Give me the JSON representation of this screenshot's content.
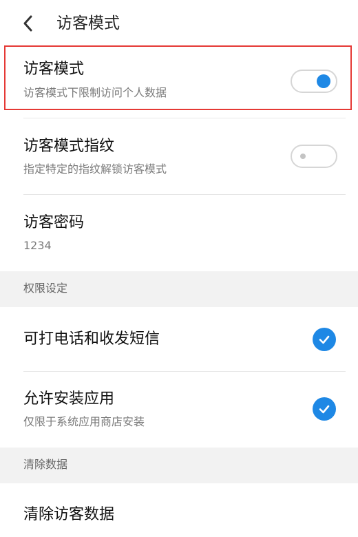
{
  "header": {
    "title": "访客模式",
    "back_icon": "chevron-left-icon"
  },
  "settings": {
    "guest_mode": {
      "title": "访客模式",
      "subtitle": "访客模式下限制访问个人数据",
      "enabled": true
    },
    "guest_fingerprint": {
      "title": "访客模式指纹",
      "subtitle": "指定特定的指纹解锁访客模式",
      "enabled": false
    },
    "guest_password": {
      "title": "访客密码",
      "value": "1234"
    }
  },
  "permissions": {
    "section_label": "权限设定",
    "calls_sms": {
      "title": "可打电话和收发短信",
      "checked": true
    },
    "install_apps": {
      "title": "允许安装应用",
      "subtitle": "仅限于系统应用商店安装",
      "checked": true
    }
  },
  "clear": {
    "section_label": "清除数据",
    "clear_guest_data": {
      "title": "清除访客数据"
    }
  },
  "colors": {
    "accent": "#1e88e5",
    "highlight": "#e53935",
    "section_bg": "#f2f2f2"
  }
}
